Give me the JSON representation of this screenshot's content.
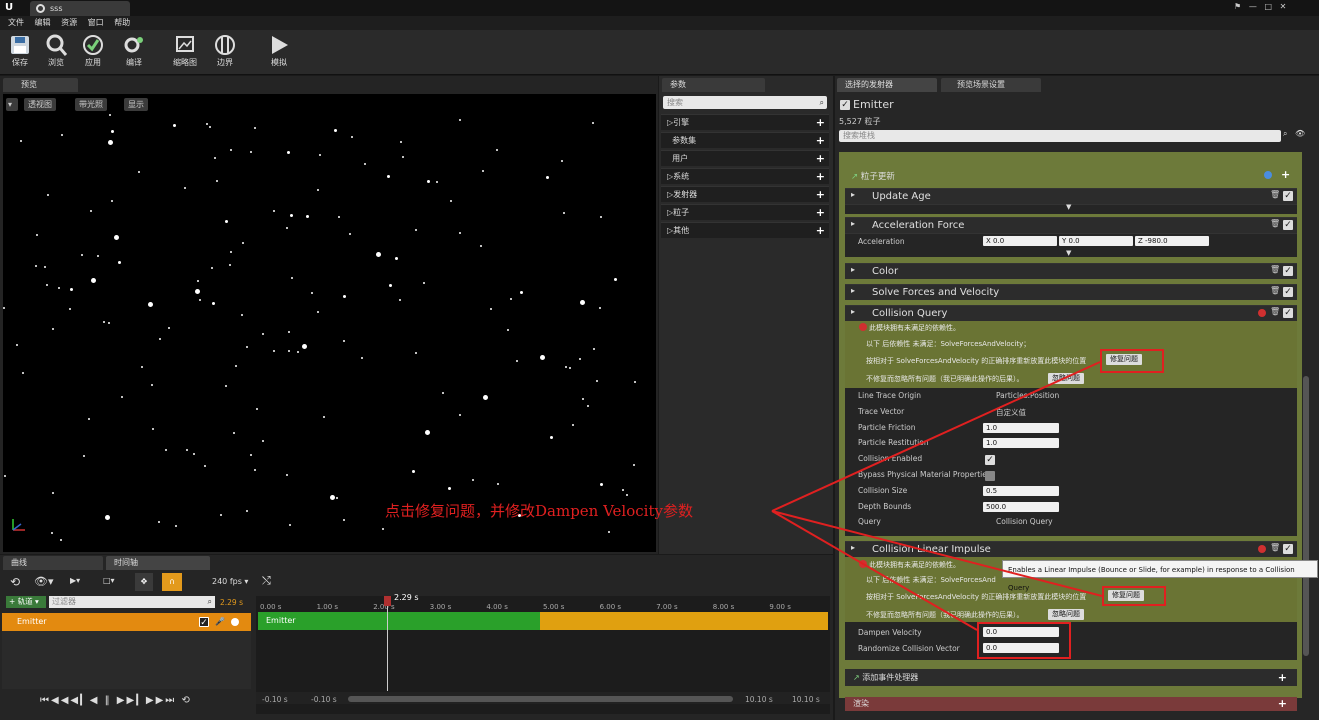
{
  "titlebar": {
    "tab_title": "sss"
  },
  "menu": [
    "文件",
    "编辑",
    "资源",
    "窗口",
    "帮助"
  ],
  "toolbar": [
    {
      "label": "保存",
      "icon": "save-icon"
    },
    {
      "label": "浏览",
      "icon": "browse-icon"
    },
    {
      "label": "应用",
      "icon": "apply-icon"
    },
    {
      "label": "编译",
      "icon": "compile-icon"
    },
    {
      "label": "缩略图",
      "icon": "thumbnail-icon"
    },
    {
      "label": "边界",
      "icon": "bounds-icon"
    },
    {
      "label": "模拟",
      "icon": "simulate-icon"
    }
  ],
  "viewport": {
    "tab": "预览",
    "perspective": "透视图",
    "lit": "带光照",
    "show": "显示"
  },
  "params": {
    "tab": "参数",
    "search_placeholder": "搜索",
    "groups": [
      "引擎",
      "参数集",
      "用户",
      "系统",
      "发射器",
      "粒子",
      "其他"
    ]
  },
  "emitter_panel": {
    "tabs": [
      "选择的发射器",
      "预览场景设置"
    ],
    "name": "Emitter",
    "particle_count": "5,527 粒子",
    "filter_placeholder": "搜索堆栈",
    "section_particle_update": "粒子更新",
    "modules": {
      "update_age": "Update Age",
      "acceleration_force": "Acceleration Force",
      "color": "Color",
      "solve_forces": "Solve Forces and Velocity",
      "collision_query": "Collision Query",
      "collision_linear_impulse": "Collision Linear Impulse"
    },
    "acceleration": {
      "label": "Acceleration",
      "x": "X 0.0",
      "y": "Y 0.0",
      "z": "Z -980.0"
    },
    "warning": {
      "line1": "此模块拥有未满足的依赖性。",
      "line2": "以下 后依赖性 未满足：SolveForcesAndVelocity；",
      "line3": "按相对于 SolveForcesAndVelocity 的正确排序重新放置此模块的位置",
      "line4": "不修复而忽略所有问题（我已明确此操作的后果）。",
      "fix_btn": "修复问题",
      "ignore_btn": "忽略问题"
    },
    "warning2": {
      "line2": "以下 后依赖性 未满足：SolveForcesAnd",
      "line3": "按相对于 SolveForcesAndVelocity 的正确排序重新放置此模块的位置",
      "line4": "不修复而忽略所有问题（我已明确此操作的后果）。"
    },
    "collision_props": [
      {
        "label": "Line Trace Origin",
        "value": "Particles.Position"
      },
      {
        "label": "Trace Vector",
        "value": "自定义值"
      },
      {
        "label": "Particle Friction",
        "value": "1.0"
      },
      {
        "label": "Particle Restitution",
        "value": "1.0"
      },
      {
        "label": "Collision Enabled",
        "value": ""
      },
      {
        "label": "Bypass Physical Material Properties",
        "value": ""
      },
      {
        "label": "Collision Size",
        "value": "0.5"
      },
      {
        "label": "Depth Bounds",
        "value": "500.0"
      },
      {
        "label": "Query",
        "value": "Collision Query"
      }
    ],
    "impulse_props": [
      {
        "label": "Dampen Velocity",
        "value": "0.0"
      },
      {
        "label": "Randomize Collision Vector",
        "value": "0.0"
      }
    ],
    "tooltip": "Enables a Linear Impulse (Bounce or Slide, for example) in response to a Collision Query",
    "add_event_handler": "添加事件处理器",
    "render": "渲染"
  },
  "annotation": "点击修复问题，并修改Dampen Velocity参数",
  "timeline": {
    "tabs": [
      "曲线",
      "时间轴"
    ],
    "fps": "240 fps",
    "track_btn": "轨道",
    "filter_placeholder": "过滤器",
    "current_time": "2.29 s",
    "playhead_label": "2.29 s",
    "ticks": [
      "0.00 s",
      "1.00 s",
      "2.00 s",
      "3.00 s",
      "4.00 s",
      "5.00 s",
      "6.00 s",
      "7.00 s",
      "8.00 s",
      "9.00 s"
    ],
    "track_name": "Emitter",
    "bar_label": "Emitter",
    "range_start": [
      "-0.10 s",
      "-0.10 s"
    ],
    "range_end": [
      "10.10 s",
      "10.10 s"
    ]
  }
}
